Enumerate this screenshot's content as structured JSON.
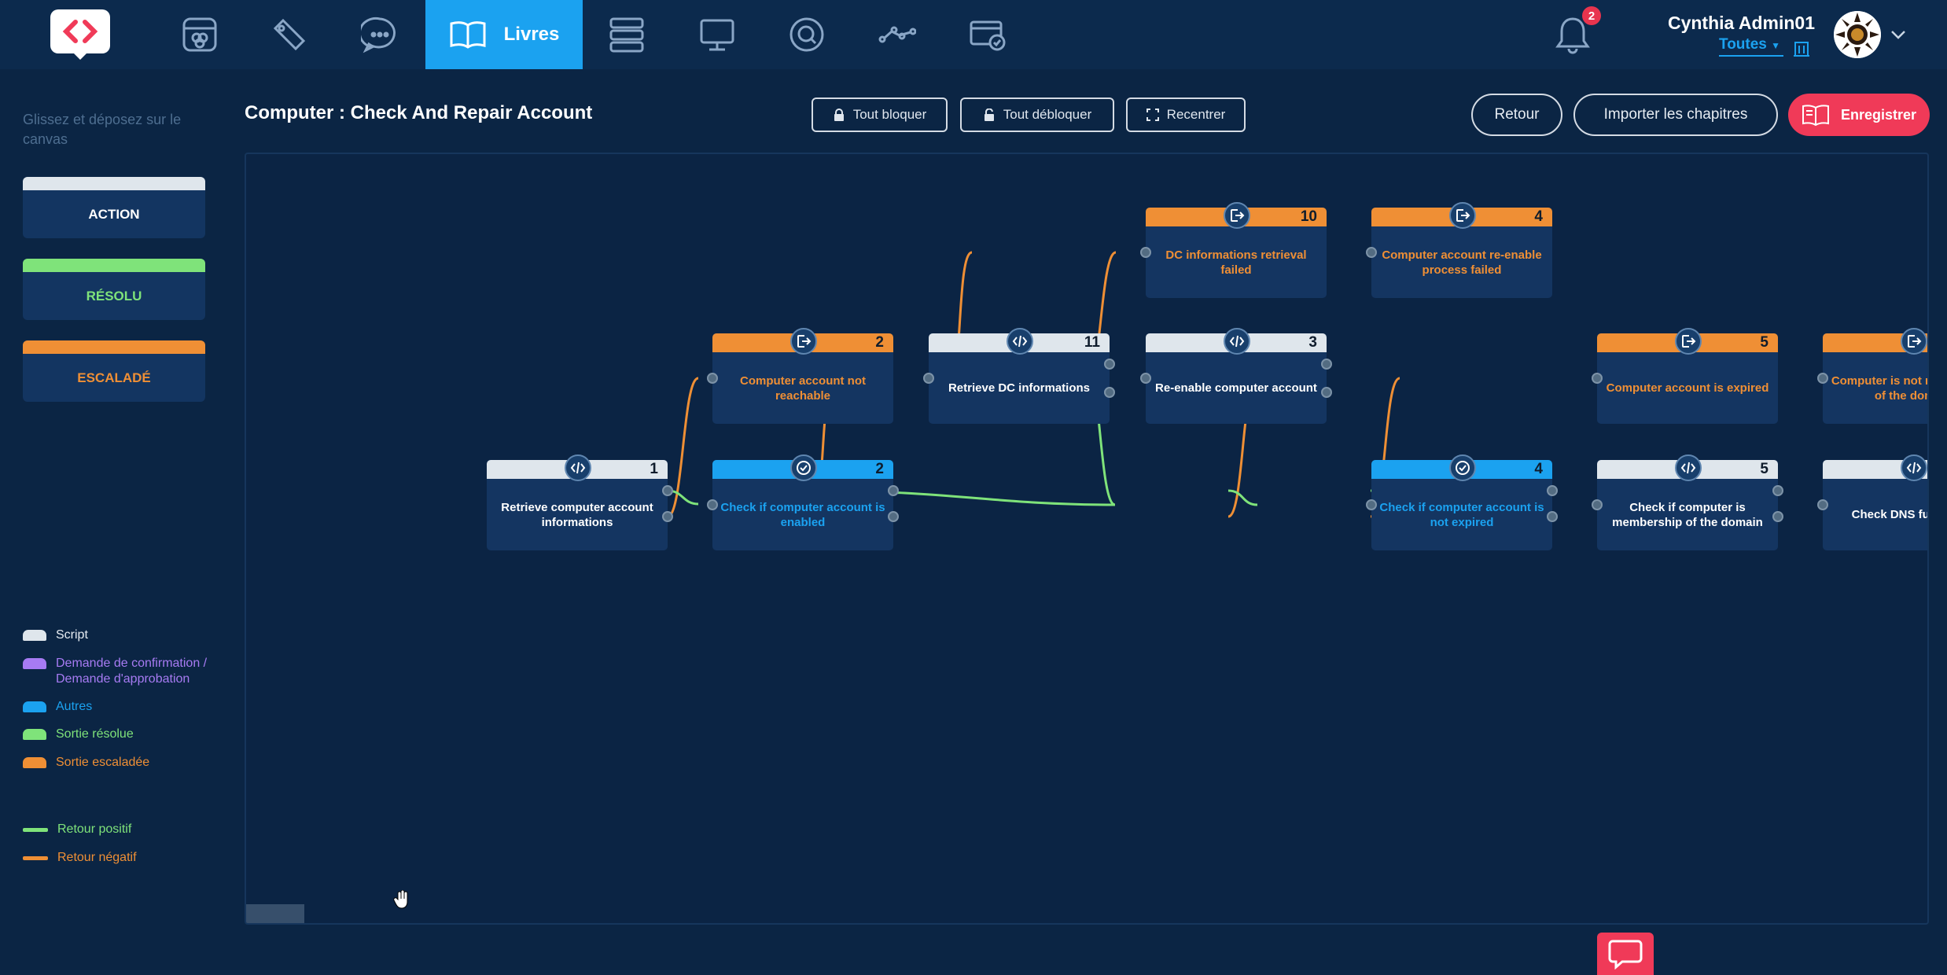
{
  "nav": {
    "active_label": "Livres",
    "icons": [
      "dashboard-icon",
      "ticket-icon",
      "chat-icon",
      "book-icon",
      "server-icon",
      "monitor-icon",
      "search-icon",
      "workflow-icon",
      "payment-icon"
    ],
    "notifications_count": "2"
  },
  "user": {
    "name": "Cynthia Admin01",
    "org_selector": "Toutes"
  },
  "sidebar": {
    "hint": "Glissez et déposez sur le canvas",
    "palette": [
      {
        "label": "ACTION",
        "color": "#dfe6ec"
      },
      {
        "label": "RÉSOLU",
        "color": "#7fe37a"
      },
      {
        "label": "ESCALADÉ",
        "color": "#ef8f35"
      }
    ],
    "legend": [
      {
        "label": "Script",
        "color": "#dfe6ec"
      },
      {
        "label": "Demande de confirmation / Demande d'approbation",
        "color": "#a77bf3"
      },
      {
        "label": "Autres",
        "color": "#1ba2f0"
      },
      {
        "label": "Sortie résolue",
        "color": "#7fe37a"
      },
      {
        "label": "Sortie escaladée",
        "color": "#ef8f35"
      }
    ],
    "lines": [
      {
        "label": "Retour positif",
        "color": "#7fe37a"
      },
      {
        "label": "Retour négatif",
        "color": "#ef8f35"
      }
    ]
  },
  "page": {
    "title": "Computer : Check And Repair Account"
  },
  "toolbar": {
    "lock_all": "Tout bloquer",
    "unlock_all": "Tout débloquer",
    "recenter": "Recentrer",
    "back": "Retour",
    "import": "Importer les chapitres",
    "save": "Enregistrer"
  },
  "nodes": [
    {
      "id": "n1",
      "num": "1",
      "kind": "script",
      "label": "Retrieve computer account informations"
    },
    {
      "id": "n2",
      "num": "2",
      "kind": "escalated",
      "label": "Computer account not reachable"
    },
    {
      "id": "n3",
      "num": "2",
      "kind": "other",
      "label": "Check if computer account is enabled"
    },
    {
      "id": "n4",
      "num": "11",
      "kind": "script",
      "label": "Retrieve DC informations"
    },
    {
      "id": "n5",
      "num": "10",
      "kind": "escalated",
      "label": "DC informations retrieval failed"
    },
    {
      "id": "n6",
      "num": "3",
      "kind": "script",
      "label": "Re-enable computer account"
    },
    {
      "id": "n7",
      "num": "4",
      "kind": "escalated",
      "label": "Computer account re-enable process failed"
    },
    {
      "id": "n8",
      "num": "4",
      "kind": "other",
      "label": "Check if computer account is not expired"
    },
    {
      "id": "n9",
      "num": "5",
      "kind": "escalated",
      "label": "Computer account is expired"
    },
    {
      "id": "n10",
      "num": "5",
      "kind": "script",
      "label": "Check if computer is membership of the domain"
    },
    {
      "id": "n11",
      "num": "",
      "kind": "escalated",
      "label": "Computer is not membership of the domain"
    },
    {
      "id": "n12",
      "num": "",
      "kind": "script",
      "label": "Check DNS functional"
    }
  ],
  "colors": {
    "script": "#dfe6ec",
    "other": "#1ba2f0",
    "escalated": "#ef8f35",
    "positive": "#7fe37a",
    "negative": "#ef8f35",
    "accent": "#f03a58"
  }
}
